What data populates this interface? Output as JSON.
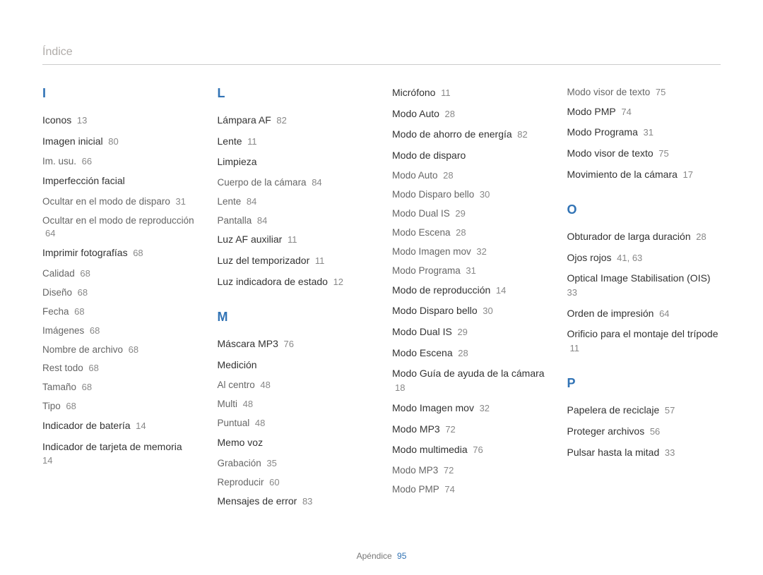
{
  "header": "Índice",
  "footer": {
    "label": "Apéndice",
    "page": "95"
  },
  "columns": [
    [
      {
        "type": "head",
        "text": "I"
      },
      {
        "type": "entry",
        "label": "Iconos",
        "page": "13"
      },
      {
        "type": "entry",
        "label": "Imagen inicial",
        "page": "80"
      },
      {
        "type": "sub",
        "label": "Im. usu.",
        "page": "66"
      },
      {
        "type": "entry",
        "label": "Imperfección facial"
      },
      {
        "type": "sub",
        "label": "Ocultar en el modo de disparo",
        "page": "31"
      },
      {
        "type": "sub",
        "label": "Ocultar en el modo de reproducción",
        "page": "64"
      },
      {
        "type": "entry",
        "label": "Imprimir fotografías",
        "page": "68"
      },
      {
        "type": "sub",
        "label": "Calidad",
        "page": "68"
      },
      {
        "type": "sub",
        "label": "Diseño",
        "page": "68"
      },
      {
        "type": "sub",
        "label": "Fecha",
        "page": "68"
      },
      {
        "type": "sub",
        "label": "Imágenes",
        "page": "68"
      },
      {
        "type": "sub",
        "label": "Nombre de archivo",
        "page": "68"
      },
      {
        "type": "sub",
        "label": "Rest todo",
        "page": "68"
      },
      {
        "type": "sub",
        "label": "Tamaño",
        "page": "68"
      },
      {
        "type": "sub",
        "label": "Tipo",
        "page": "68"
      },
      {
        "type": "entry",
        "label": "Indicador de batería",
        "page": "14"
      },
      {
        "type": "entry",
        "label": "Indicador de tarjeta de memoria",
        "page": "14"
      }
    ],
    [
      {
        "type": "head",
        "text": "L"
      },
      {
        "type": "entry",
        "label": "Lámpara AF",
        "page": "82"
      },
      {
        "type": "entry",
        "label": "Lente",
        "page": "11"
      },
      {
        "type": "entry",
        "label": "Limpieza"
      },
      {
        "type": "sub",
        "label": "Cuerpo de la cámara",
        "page": "84"
      },
      {
        "type": "sub",
        "label": "Lente",
        "page": "84"
      },
      {
        "type": "sub",
        "label": "Pantalla",
        "page": "84"
      },
      {
        "type": "entry",
        "label": "Luz AF auxiliar",
        "page": "11"
      },
      {
        "type": "entry",
        "label": "Luz del temporizador",
        "page": "11"
      },
      {
        "type": "entry",
        "label": "Luz indicadora de estado",
        "page": "12"
      },
      {
        "type": "head",
        "text": "M"
      },
      {
        "type": "entry",
        "label": "Máscara MP3",
        "page": "76"
      },
      {
        "type": "entry",
        "label": "Medición"
      },
      {
        "type": "sub",
        "label": "Al centro",
        "page": "48"
      },
      {
        "type": "sub",
        "label": "Multi",
        "page": "48"
      },
      {
        "type": "sub",
        "label": "Puntual",
        "page": "48"
      },
      {
        "type": "entry",
        "label": "Memo voz"
      },
      {
        "type": "sub",
        "label": "Grabación",
        "page": "35"
      },
      {
        "type": "sub",
        "label": "Reproducir",
        "page": "60"
      },
      {
        "type": "entry",
        "label": "Mensajes de error",
        "page": "83"
      }
    ],
    [
      {
        "type": "entry",
        "label": "Micrófono",
        "page": "11"
      },
      {
        "type": "entry",
        "label": "Modo Auto",
        "page": "28"
      },
      {
        "type": "entry",
        "label": "Modo de ahorro de energía",
        "page": "82"
      },
      {
        "type": "entry",
        "label": "Modo de disparo"
      },
      {
        "type": "sub",
        "label": "Modo Auto",
        "page": "28"
      },
      {
        "type": "sub",
        "label": "Modo Disparo bello",
        "page": "30"
      },
      {
        "type": "sub",
        "label": "Modo Dual IS",
        "page": "29"
      },
      {
        "type": "sub",
        "label": "Modo Escena",
        "page": "28"
      },
      {
        "type": "sub",
        "label": "Modo Imagen mov",
        "page": "32"
      },
      {
        "type": "sub",
        "label": "Modo Programa",
        "page": "31"
      },
      {
        "type": "entry",
        "label": "Modo de reproducción",
        "page": "14"
      },
      {
        "type": "entry",
        "label": "Modo Disparo bello",
        "page": "30"
      },
      {
        "type": "entry",
        "label": "Modo Dual IS",
        "page": "29"
      },
      {
        "type": "entry",
        "label": "Modo Escena",
        "page": "28"
      },
      {
        "type": "entry",
        "label": "Modo Guía de ayuda de la cámara",
        "page": "18"
      },
      {
        "type": "entry",
        "label": "Modo Imagen mov",
        "page": "32"
      },
      {
        "type": "entry",
        "label": "Modo MP3",
        "page": "72"
      },
      {
        "type": "entry",
        "label": "Modo multimedia",
        "page": "76"
      },
      {
        "type": "sub",
        "label": "Modo MP3",
        "page": "72"
      },
      {
        "type": "sub",
        "label": "Modo PMP",
        "page": "74"
      }
    ],
    [
      {
        "type": "sub",
        "label": "Modo visor de texto",
        "page": "75"
      },
      {
        "type": "entry",
        "label": "Modo PMP",
        "page": "74"
      },
      {
        "type": "entry",
        "label": "Modo Programa",
        "page": "31"
      },
      {
        "type": "entry",
        "label": "Modo visor de texto",
        "page": "75"
      },
      {
        "type": "entry",
        "label": "Movimiento de la cámara",
        "page": "17"
      },
      {
        "type": "head",
        "text": "O"
      },
      {
        "type": "entry",
        "label": "Obturador de larga duración",
        "page": "28"
      },
      {
        "type": "entry",
        "label": "Ojos rojos",
        "page": "41, 63"
      },
      {
        "type": "entry",
        "label": "Optical Image Stabilisation (OIS)",
        "page": "33"
      },
      {
        "type": "entry",
        "label": "Orden de impresión",
        "page": "64"
      },
      {
        "type": "entry",
        "label": "Orificio para el montaje del trípode",
        "page": "11"
      },
      {
        "type": "head",
        "text": "P"
      },
      {
        "type": "entry",
        "label": "Papelera de reciclaje",
        "page": "57"
      },
      {
        "type": "entry",
        "label": "Proteger archivos",
        "page": "56"
      },
      {
        "type": "entry",
        "label": "Pulsar hasta la mitad",
        "page": "33"
      }
    ]
  ]
}
